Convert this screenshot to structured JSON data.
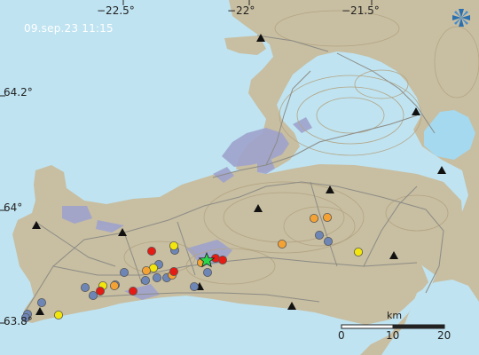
{
  "timestamp": "09.sep.23  11:15",
  "longitude_labels": [
    "−22.5°",
    "−22°",
    "−21.5°"
  ],
  "latitude_labels": [
    "64.2°",
    "64°",
    "63.8°"
  ],
  "scale": {
    "unit": "km",
    "ticks": [
      "0",
      "10",
      "20"
    ]
  },
  "icons": {
    "compass": "compass-icon",
    "main_event": "green-star-icon",
    "stations": "station-triangle-icon"
  },
  "colors": {
    "sea": "#bfe3f1",
    "land": "#c8bea1",
    "lakes": "#a4d9ef",
    "lava": "#9ea3cd",
    "roads": "#8c8c86",
    "recent": "#e41c13",
    "hours": "#f4a233",
    "day": "#f2e60c",
    "older": "#6e86b6",
    "star": "#2bd64b"
  },
  "legend_note": "",
  "earthquakes": {
    "red": [
      [
        171,
        283
      ],
      [
        113,
        328
      ],
      [
        150,
        328
      ],
      [
        196,
        306
      ],
      [
        243,
        291
      ],
      [
        251,
        293
      ]
    ],
    "orange": [
      [
        354,
        246
      ],
      [
        369,
        245
      ],
      [
        318,
        275
      ],
      [
        227,
        296
      ],
      [
        194,
        310
      ],
      [
        165,
        305
      ],
      [
        129,
        322
      ]
    ],
    "yellow": [
      [
        404,
        284
      ],
      [
        196,
        277
      ],
      [
        173,
        302
      ],
      [
        116,
        322
      ],
      [
        66,
        355
      ]
    ],
    "blue": [
      [
        360,
        265
      ],
      [
        370,
        272
      ],
      [
        234,
        307
      ],
      [
        219,
        323
      ],
      [
        197,
        282
      ],
      [
        179,
        298
      ],
      [
        188,
        313
      ],
      [
        164,
        316
      ],
      [
        177,
        313
      ],
      [
        140,
        307
      ],
      [
        96,
        324
      ],
      [
        105,
        333
      ],
      [
        47,
        341
      ],
      [
        31,
        354
      ],
      [
        29,
        358
      ],
      [
        130,
        321
      ]
    ]
  },
  "stations": [
    [
      294,
      43
    ],
    [
      469,
      126
    ],
    [
      498,
      192
    ],
    [
      372,
      214
    ],
    [
      291,
      235
    ],
    [
      41,
      254
    ],
    [
      138,
      262
    ],
    [
      225,
      323
    ],
    [
      444,
      288
    ],
    [
      329,
      345
    ],
    [
      45,
      351
    ]
  ]
}
